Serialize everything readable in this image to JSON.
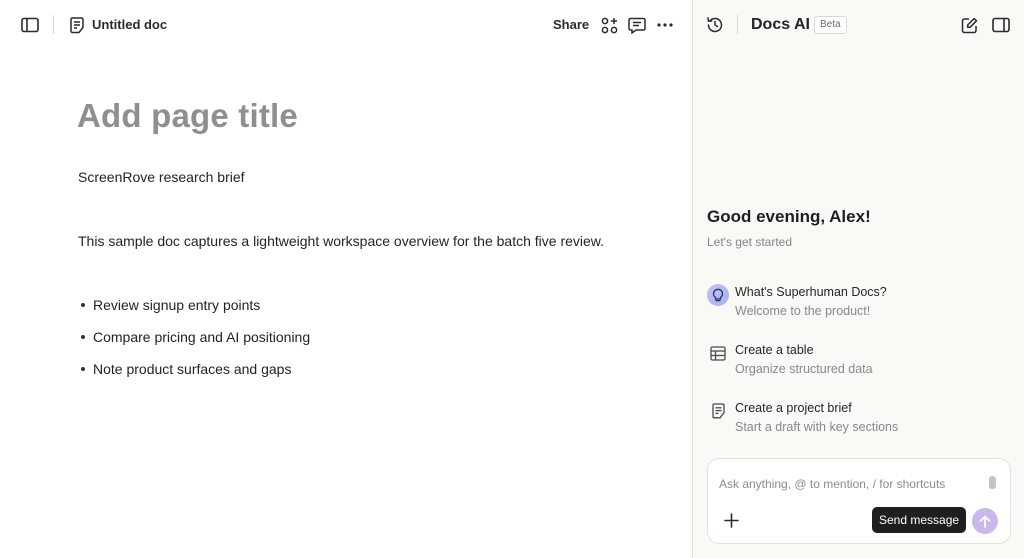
{
  "topbar": {
    "doc_title": "Untitled doc",
    "share_label": "Share",
    "icons": [
      "sidebar-toggle-icon",
      "document-icon",
      "apps-add-icon",
      "comment-icon",
      "more-icon"
    ]
  },
  "editor": {
    "title_placeholder": "Add page title",
    "paragraphs": [
      "ScreenRove research brief",
      "This sample doc captures a lightweight workspace overview for the batch five review."
    ],
    "bullets": [
      "Review signup entry points",
      "Compare pricing and AI positioning",
      "Note product surfaces and gaps"
    ]
  },
  "ai_panel": {
    "title": "Docs AI",
    "badge": "Beta",
    "greeting": "Good evening, Alex!",
    "subgreeting": "Let's get started",
    "suggestions": [
      {
        "title": "What's Superhuman Docs?",
        "description": "Welcome to the product!",
        "icon": "lightbulb-icon"
      },
      {
        "title": "Create a table",
        "description": "Organize structured data",
        "icon": "table-icon"
      },
      {
        "title": "Create a project brief",
        "description": "Start a draft with key sections",
        "icon": "document-icon"
      }
    ],
    "composer": {
      "placeholder": "Ask anything, @ to mention, / for shortcuts",
      "value": "",
      "send_tooltip": "Send message"
    }
  },
  "colors": {
    "panel_bg": "#faf9f6",
    "send_button": "#c8b8ee",
    "title_placeholder": "#8f8f8f",
    "tooltip_bg": "#1f1f1f"
  }
}
